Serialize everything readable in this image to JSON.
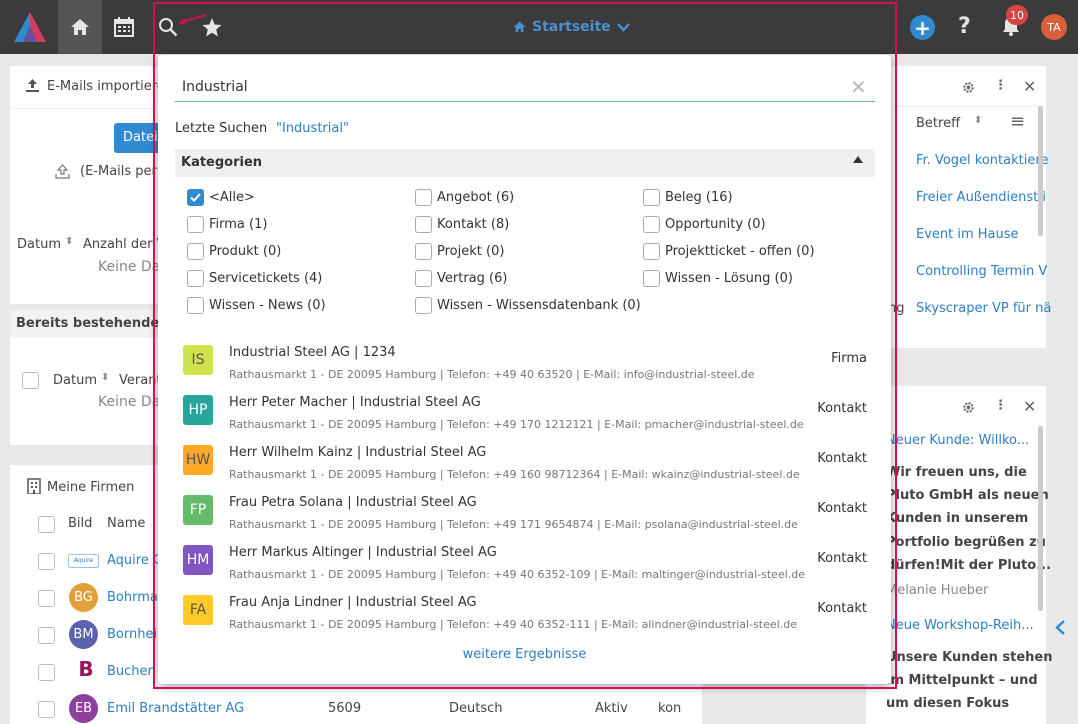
{
  "topbar": {
    "page_title": "Startseite",
    "notifications_count": "10",
    "user_initials": "TA",
    "add_label": "+",
    "help_label": "?"
  },
  "background": {
    "import_card_title": "E-Mails importieren",
    "upload_button": "Datei",
    "upload_hint": "(E-Mails per D",
    "col_date": "Datum",
    "col_count": "Anzahl der V",
    "no_data_1": "Keine Da",
    "existing_title": "Bereits bestehende Ak",
    "col_date2": "Datum",
    "col_sender": "Verant",
    "no_data_2": "Keine Da",
    "firms_title": "Meine Firmen",
    "col_image": "Bild",
    "col_name": "Name",
    "firms": [
      {
        "initials": "",
        "name": "Aquire G"
      },
      {
        "initials": "BG",
        "name": "Bohrmar"
      },
      {
        "initials": "BM",
        "name": "Bornhei"
      },
      {
        "initials": "B",
        "name": "Bucher"
      },
      {
        "initials": "EB",
        "name": "Emil Brandstätter AG",
        "number": "5609",
        "language": "Deutsch",
        "status": "Aktiv",
        "extra": "kon"
      }
    ],
    "right_top": {
      "col_subject": "Betreff",
      "items": [
        "Fr. Vogel kontaktiere",
        "Freier Außendienst i",
        "Event im Hause",
        "Controlling Termin V",
        "Skyscraper VP für nä"
      ],
      "cut_prefix": "ng"
    },
    "right_bottom": {
      "news1_title": "Neuer Kunde: Willko...",
      "news1_body": [
        "Wir freuen uns, die",
        "Pluto GmbH als neuen",
        "Kunden in unserem",
        "Portfolio begrüßen zu",
        "dürfen!Mit der Pluto..."
      ],
      "news1_author": "Melanie Hueber",
      "news2_title": "Neue Workshop-Reih...",
      "news2_body": [
        "Unsere Kunden stehen",
        "im Mittelpunkt – und",
        "um diesen Fokus"
      ]
    }
  },
  "search": {
    "query": "Industrial",
    "recent_label": "Letzte Suchen",
    "recent_item": "\"Industrial\"",
    "categories_title": "Kategorien",
    "categories": [
      {
        "label": "<Alle>",
        "checked": true
      },
      {
        "label": "Angebot (6)",
        "checked": false
      },
      {
        "label": "Beleg (16)",
        "checked": false
      },
      {
        "label": "Firma (1)",
        "checked": false
      },
      {
        "label": "Kontakt (8)",
        "checked": false
      },
      {
        "label": "Opportunity (0)",
        "checked": false
      },
      {
        "label": "Produkt (0)",
        "checked": false
      },
      {
        "label": "Projekt (0)",
        "checked": false
      },
      {
        "label": "Projektticket - offen (0)",
        "checked": false
      },
      {
        "label": "Servicetickets (4)",
        "checked": false
      },
      {
        "label": "Vertrag (6)",
        "checked": false
      },
      {
        "label": "Wissen - Lösung (0)",
        "checked": false
      },
      {
        "label": "Wissen - News (0)",
        "checked": false
      },
      {
        "label": "Wissen - Wissensdatenbank (0)",
        "checked": false
      }
    ],
    "results": [
      {
        "initials": "IS",
        "color": "#cfe34e",
        "text_color": "#555",
        "title": "Industrial Steel AG | 1234",
        "subtitle": "Rathausmarkt 1 - DE 20095 Hamburg | Telefon: +49 40 63520 | E-Mail: info@industrial-steel.de",
        "type": "Firma"
      },
      {
        "initials": "HP",
        "color": "#26a69a",
        "text_color": "#fff",
        "title": "Herr Peter Macher | Industrial Steel AG",
        "subtitle": "Rathausmarkt 1 - DE 20095 Hamburg | Telefon: +49 170 1212121 | E-Mail: pmacher@industrial-steel.de",
        "type": "Kontakt"
      },
      {
        "initials": "HW",
        "color": "#ffa726",
        "text_color": "#555",
        "title": "Herr Wilhelm Kainz | Industrial Steel AG",
        "subtitle": "Rathausmarkt 1 - DE 20095 Hamburg | Telefon: +49 160 98712364 | E-Mail: wkainz@industrial-steel.de",
        "type": "Kontakt"
      },
      {
        "initials": "FP",
        "color": "#66bb6a",
        "text_color": "#fff",
        "title": "Frau Petra Solana | Industrial Steel AG",
        "subtitle": "Rathausmarkt 1 - DE 20095 Hamburg | Telefon: +49 171 9654874 | E-Mail: psolana@industrial-steel.de",
        "type": "Kontakt"
      },
      {
        "initials": "HM",
        "color": "#7e57c2",
        "text_color": "#fff",
        "title": "Herr Markus Altinger | Industrial Steel AG",
        "subtitle": "Rathausmarkt 1 - DE 20095 Hamburg | Telefon: +49 40 6352-109 | E-Mail: maltinger@industrial-steel.de",
        "type": "Kontakt"
      },
      {
        "initials": "FA",
        "color": "#ffca28",
        "text_color": "#555",
        "title": "Frau Anja Lindner | Industrial Steel AG",
        "subtitle": "Rathausmarkt 1 - DE 20095 Hamburg | Telefon: +49 40 6352-111 | E-Mail: alindner@industrial-steel.de",
        "type": "Kontakt"
      }
    ],
    "more_results": "weitere Ergebnisse"
  }
}
